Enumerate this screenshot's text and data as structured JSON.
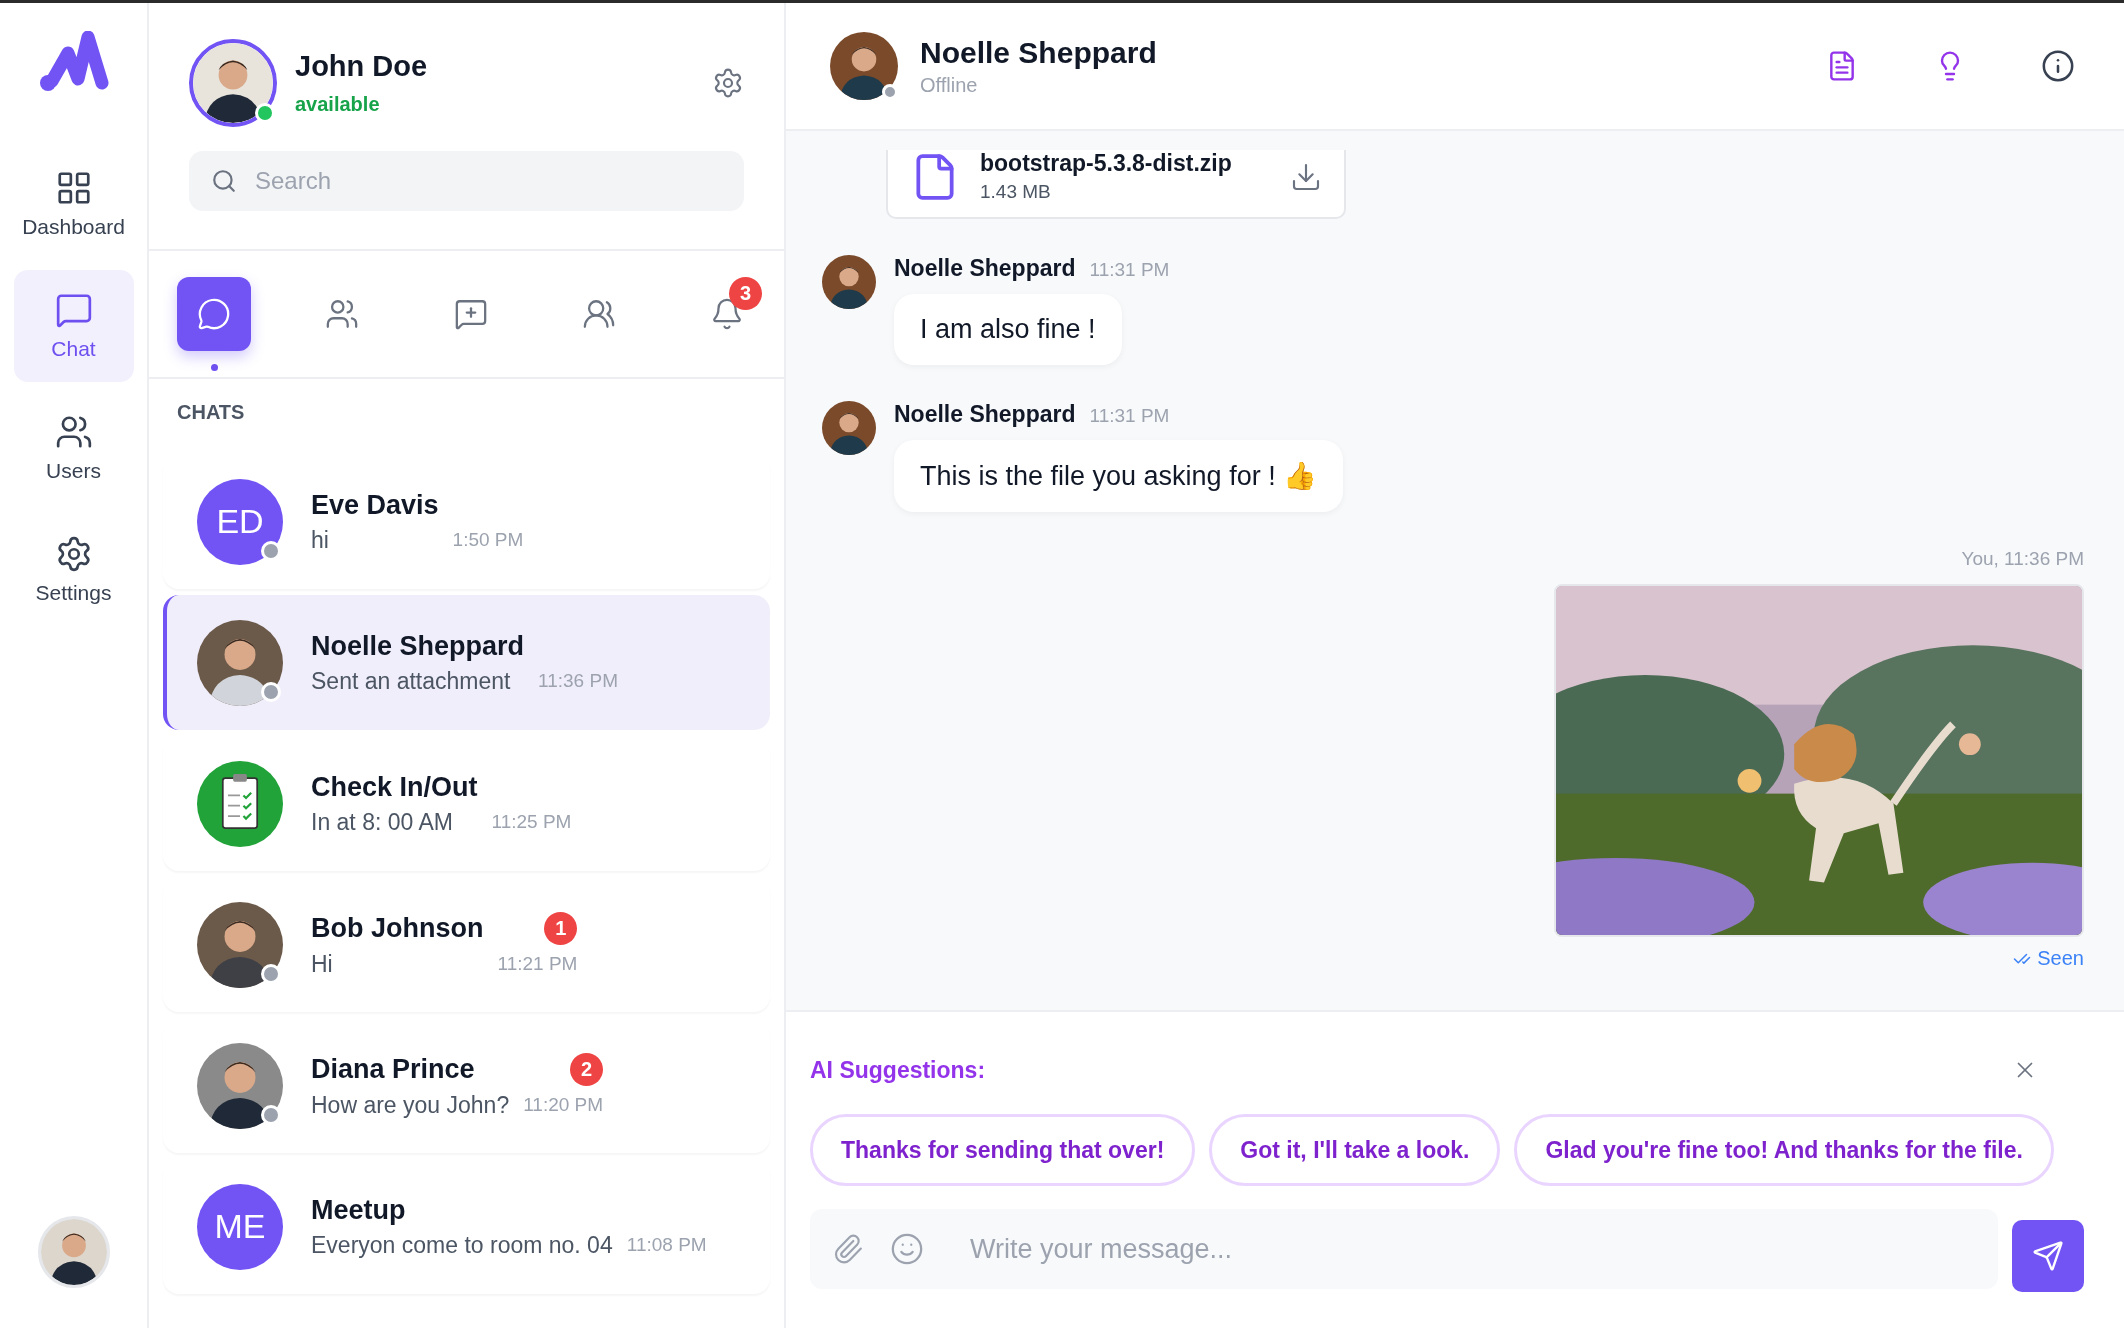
{
  "rail": {
    "items": [
      {
        "kind": "dashboard",
        "label": "Dashboard",
        "selected": false
      },
      {
        "kind": "chat",
        "label": "Chat",
        "selected": true
      },
      {
        "kind": "users",
        "label": "Users",
        "selected": false
      },
      {
        "kind": "settings",
        "label": "Settings",
        "selected": false
      }
    ]
  },
  "profile": {
    "name": "John Doe",
    "status": "available",
    "online": true
  },
  "search": {
    "placeholder": "Search"
  },
  "tabs": [
    {
      "kind": "chat",
      "selected": true
    },
    {
      "kind": "users",
      "selected": false
    },
    {
      "kind": "new-chat",
      "selected": false
    },
    {
      "kind": "groups",
      "selected": false
    },
    {
      "kind": "bell",
      "selected": false,
      "badge": "3"
    }
  ],
  "chats_heading": "CHATS",
  "chats": [
    {
      "name": "Eve Davis",
      "preview": "hi",
      "time": "1:50 PM",
      "avatar": {
        "kind": "initials",
        "text": "ED"
      },
      "online": false,
      "selected": false
    },
    {
      "name": "Noelle Sheppard",
      "preview": "Sent an attachment",
      "time": "11:36 PM",
      "online": false,
      "selected": true
    },
    {
      "name": "Check In/Out",
      "preview": "In at 8: 00 AM",
      "time": "11:25 PM",
      "avatar": {
        "kind": "clipboard"
      },
      "selected": false
    },
    {
      "name": "Bob Johnson",
      "preview": "Hi",
      "time": "11:21 PM",
      "badge": "1",
      "online": false,
      "selected": false
    },
    {
      "name": "Diana Prince",
      "preview": "How are you John?",
      "time": "11:20 PM",
      "badge": "2",
      "online": false,
      "selected": false
    },
    {
      "name": "Meetup",
      "preview": "Everyon come to room no. 04",
      "time": "11:08 PM",
      "avatar": {
        "kind": "initials",
        "text": "ME"
      },
      "selected": false
    }
  ],
  "conversation": {
    "name": "Noelle Sheppard",
    "status": "Offline",
    "online": false,
    "actions": [
      {
        "kind": "document"
      },
      {
        "kind": "bulb"
      },
      {
        "kind": "info"
      }
    ]
  },
  "messages": [
    {
      "kind": "file",
      "file_name": "bootstrap-5.3.8-dist.zip",
      "size": "1.43 MB"
    },
    {
      "kind": "text",
      "sender": "Noelle Sheppard",
      "time": "11:31 PM",
      "text": "I am also fine !"
    },
    {
      "kind": "text",
      "sender": "Noelle Sheppard",
      "time": "11:31 PM",
      "text": "This is the file you asking for ! 👍"
    },
    {
      "meta": "You, 11:36 PM",
      "receipt": "Seen"
    }
  ],
  "suggestions": {
    "label": "AI Suggestions:",
    "items": [
      "Thanks for sending that over!",
      "Got it, I'll take a look.",
      "Glad you're fine too! And thanks for the file."
    ]
  },
  "composer": {
    "placeholder": "Write your message..."
  }
}
